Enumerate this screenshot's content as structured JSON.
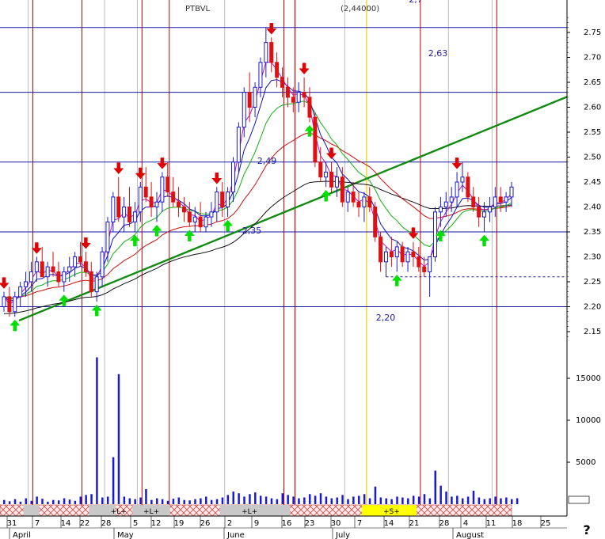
{
  "chart_data": {
    "type": "candlestick",
    "title": "PTBVL",
    "title_overlay": "(2,44000)",
    "price_axis": {
      "ylim": [
        2.13,
        2.79
      ],
      "ticks": [
        "2.75",
        "2.70",
        "2.65",
        "2.60",
        "2.55",
        "2.50",
        "2.45",
        "2.40",
        "2.35",
        "2.30",
        "2.25",
        "2.20",
        "2.15"
      ]
    },
    "volume_axis": {
      "ylim": [
        0,
        19000
      ],
      "ticks": [
        "15000",
        "10000",
        "5000"
      ]
    },
    "horizontal_levels": [
      {
        "value": 2.76,
        "label": ""
      },
      {
        "value": 2.63,
        "label": "2,63"
      },
      {
        "value": 2.49,
        "label": "2,49"
      },
      {
        "value": 2.35,
        "label": "2,35"
      },
      {
        "value": 2.2,
        "label": "2,20"
      }
    ],
    "top_clipped_label": "2,7",
    "dashed_support": {
      "value": 2.26
    },
    "trendline": {
      "from": [
        0,
        2.16
      ],
      "to": [
        94,
        2.58
      ]
    },
    "months": [
      "April",
      "May",
      "June",
      "July",
      "August"
    ],
    "date_ticks": [
      "31",
      "7",
      "14",
      "22",
      "28",
      "5",
      "12",
      "19",
      "26",
      "2",
      "9",
      "16",
      "23",
      "30",
      "7",
      "14",
      "21",
      "28",
      "4",
      "11",
      "18",
      "25"
    ],
    "band_labels": [
      "+L+",
      "+L+",
      "+L+",
      "+S+"
    ],
    "help_label": "?",
    "candles": [
      [
        2.2,
        2.23,
        2.19,
        2.22
      ],
      [
        2.22,
        2.24,
        2.18,
        2.19
      ],
      [
        2.19,
        2.23,
        2.18,
        2.22
      ],
      [
        2.22,
        2.25,
        2.2,
        2.24
      ],
      [
        2.24,
        2.27,
        2.22,
        2.25
      ],
      [
        2.25,
        2.29,
        2.23,
        2.27
      ],
      [
        2.27,
        2.3,
        2.25,
        2.29
      ],
      [
        2.29,
        2.32,
        2.26,
        2.26
      ],
      [
        2.26,
        2.29,
        2.24,
        2.28
      ],
      [
        2.28,
        2.31,
        2.26,
        2.27
      ],
      [
        2.27,
        2.29,
        2.24,
        2.25
      ],
      [
        2.25,
        2.28,
        2.23,
        2.27
      ],
      [
        2.27,
        2.3,
        2.25,
        2.28
      ],
      [
        2.28,
        2.31,
        2.26,
        2.3
      ],
      [
        2.3,
        2.33,
        2.28,
        2.29
      ],
      [
        2.29,
        2.31,
        2.26,
        2.27
      ],
      [
        2.27,
        2.29,
        2.22,
        2.23
      ],
      [
        2.23,
        2.27,
        2.21,
        2.26
      ],
      [
        2.26,
        2.32,
        2.24,
        2.31
      ],
      [
        2.31,
        2.38,
        2.29,
        2.37
      ],
      [
        2.37,
        2.43,
        2.35,
        2.42
      ],
      [
        2.42,
        2.46,
        2.37,
        2.38
      ],
      [
        2.38,
        2.42,
        2.35,
        2.4
      ],
      [
        2.4,
        2.44,
        2.36,
        2.37
      ],
      [
        2.37,
        2.41,
        2.35,
        2.39
      ],
      [
        2.39,
        2.45,
        2.37,
        2.44
      ],
      [
        2.44,
        2.48,
        2.41,
        2.42
      ],
      [
        2.42,
        2.45,
        2.38,
        2.4
      ],
      [
        2.4,
        2.43,
        2.37,
        2.41
      ],
      [
        2.41,
        2.47,
        2.39,
        2.46
      ],
      [
        2.46,
        2.49,
        2.42,
        2.43
      ],
      [
        2.43,
        2.46,
        2.4,
        2.41
      ],
      [
        2.41,
        2.44,
        2.38,
        2.4
      ],
      [
        2.4,
        2.42,
        2.37,
        2.39
      ],
      [
        2.39,
        2.41,
        2.36,
        2.37
      ],
      [
        2.37,
        2.4,
        2.35,
        2.38
      ],
      [
        2.38,
        2.41,
        2.35,
        2.36
      ],
      [
        2.36,
        2.39,
        2.35,
        2.38
      ],
      [
        2.38,
        2.41,
        2.36,
        2.39
      ],
      [
        2.39,
        2.44,
        2.37,
        2.43
      ],
      [
        2.43,
        2.45,
        2.38,
        2.4
      ],
      [
        2.4,
        2.44,
        2.38,
        2.43
      ],
      [
        2.43,
        2.5,
        2.41,
        2.49
      ],
      [
        2.49,
        2.57,
        2.47,
        2.56
      ],
      [
        2.56,
        2.64,
        2.54,
        2.63
      ],
      [
        2.63,
        2.67,
        2.57,
        2.6
      ],
      [
        2.6,
        2.65,
        2.58,
        2.64
      ],
      [
        2.64,
        2.7,
        2.62,
        2.69
      ],
      [
        2.69,
        2.76,
        2.66,
        2.73
      ],
      [
        2.73,
        2.74,
        2.67,
        2.69
      ],
      [
        2.69,
        2.71,
        2.64,
        2.66
      ],
      [
        2.66,
        2.68,
        2.62,
        2.64
      ],
      [
        2.64,
        2.66,
        2.6,
        2.62
      ],
      [
        2.62,
        2.64,
        2.59,
        2.61
      ],
      [
        2.61,
        2.65,
        2.59,
        2.63
      ],
      [
        2.63,
        2.66,
        2.6,
        2.62
      ],
      [
        2.62,
        2.64,
        2.57,
        2.58
      ],
      [
        2.58,
        2.59,
        2.48,
        2.49
      ],
      [
        2.49,
        2.52,
        2.45,
        2.46
      ],
      [
        2.46,
        2.49,
        2.44,
        2.47
      ],
      [
        2.47,
        2.49,
        2.43,
        2.44
      ],
      [
        2.44,
        2.48,
        2.42,
        2.46
      ],
      [
        2.46,
        2.48,
        2.4,
        2.41
      ],
      [
        2.41,
        2.44,
        2.39,
        2.43
      ],
      [
        2.43,
        2.45,
        2.4,
        2.41
      ],
      [
        2.41,
        2.43,
        2.38,
        2.4
      ],
      [
        2.4,
        2.43,
        2.37,
        2.42
      ],
      [
        2.42,
        2.44,
        2.39,
        2.4
      ],
      [
        2.4,
        2.41,
        2.33,
        2.34
      ],
      [
        2.34,
        2.35,
        2.27,
        2.29
      ],
      [
        2.29,
        2.32,
        2.26,
        2.31
      ],
      [
        2.31,
        2.34,
        2.28,
        2.3
      ],
      [
        2.3,
        2.33,
        2.27,
        2.32
      ],
      [
        2.32,
        2.33,
        2.28,
        2.29
      ],
      [
        2.29,
        2.32,
        2.27,
        2.31
      ],
      [
        2.31,
        2.33,
        2.28,
        2.3
      ],
      [
        2.3,
        2.32,
        2.27,
        2.28
      ],
      [
        2.28,
        2.3,
        2.26,
        2.27
      ],
      [
        2.27,
        2.3,
        2.22,
        2.3
      ],
      [
        2.3,
        2.4,
        2.29,
        2.39
      ],
      [
        2.39,
        2.42,
        2.36,
        2.4
      ],
      [
        2.4,
        2.43,
        2.38,
        2.41
      ],
      [
        2.41,
        2.44,
        2.39,
        2.42
      ],
      [
        2.42,
        2.47,
        2.4,
        2.45
      ],
      [
        2.45,
        2.49,
        2.43,
        2.46
      ],
      [
        2.46,
        2.47,
        2.41,
        2.42
      ],
      [
        2.42,
        2.44,
        2.39,
        2.4
      ],
      [
        2.4,
        2.42,
        2.36,
        2.38
      ],
      [
        2.38,
        2.41,
        2.35,
        2.39
      ],
      [
        2.39,
        2.42,
        2.37,
        2.4
      ],
      [
        2.4,
        2.44,
        2.38,
        2.42
      ],
      [
        2.42,
        2.44,
        2.39,
        2.41
      ],
      [
        2.41,
        2.43,
        2.39,
        2.42
      ],
      [
        2.42,
        2.45,
        2.4,
        2.44
      ]
    ],
    "volumes": [
      500,
      350,
      600,
      300,
      700,
      400,
      900,
      650,
      300,
      500,
      450,
      700,
      550,
      400,
      900,
      1100,
      1200,
      17500,
      800,
      900,
      5600,
      15500,
      900,
      700,
      600,
      800,
      1800,
      500,
      700,
      600,
      400,
      650,
      800,
      500,
      450,
      600,
      700,
      900,
      500,
      600,
      800,
      1100,
      1500,
      1300,
      900,
      1200,
      1400,
      1000,
      900,
      700,
      600,
      1300,
      1100,
      900,
      700,
      800,
      1200,
      1000,
      1300,
      900,
      700,
      800,
      1100,
      600,
      900,
      1000,
      1200,
      700,
      2100,
      800,
      700,
      600,
      900,
      800,
      700,
      1000,
      900,
      1200,
      700,
      4000,
      2200,
      1500,
      900,
      1000,
      700,
      900,
      1600,
      800,
      600,
      700,
      900,
      700,
      800,
      600,
      700
    ],
    "buy_signals": [
      2,
      11,
      17,
      24,
      28,
      34,
      41,
      56,
      59,
      72,
      80,
      88
    ],
    "sell_signals": [
      0,
      6,
      15,
      21,
      25,
      29,
      39,
      49,
      55,
      60,
      75,
      83
    ],
    "red_verticals": [
      5,
      14,
      25,
      30,
      51,
      53,
      76,
      90
    ],
    "grey_verticals": [
      4,
      18,
      24,
      40,
      53,
      62,
      81,
      89
    ],
    "yellow_vertical": 66
  }
}
